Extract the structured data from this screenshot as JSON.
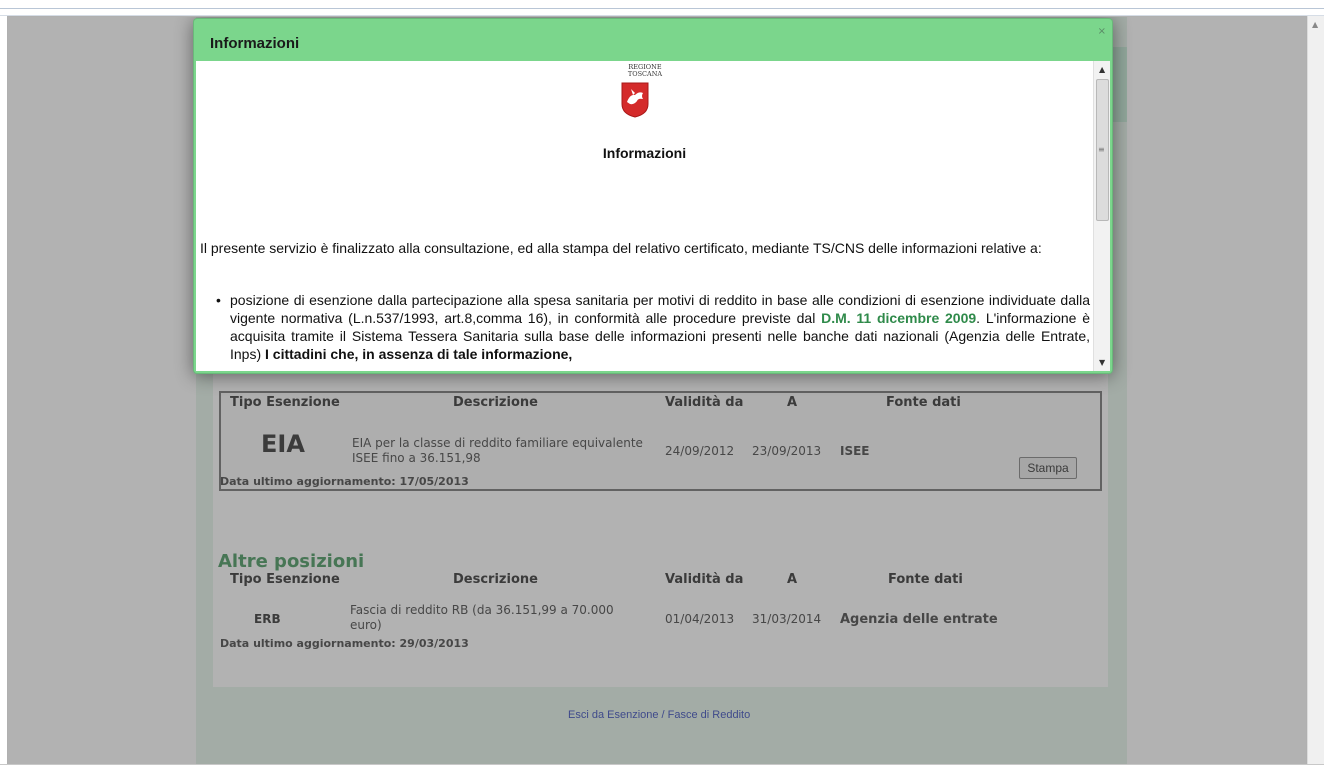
{
  "page": {
    "exempt_table": {
      "headers": [
        "Tipo Esenzione",
        "Descrizione",
        "Validità da",
        "A",
        "Fonte dati"
      ],
      "row": {
        "code": "EIA",
        "description": "EIA per la classe di reddito familiare equivalente ISEE fino a 36.151,98",
        "from": "24/09/2012",
        "to": "23/09/2013",
        "source": "ISEE",
        "print_label": "Stampa"
      },
      "last_update": "Data ultimo aggiornamento: 17/05/2013"
    },
    "other_title": "Altre posizioni",
    "other_table": {
      "headers": [
        "Tipo Esenzione",
        "Descrizione",
        "Validità da",
        "A",
        "Fonte dati"
      ],
      "row": {
        "code": "ERB",
        "description": "Fascia di reddito RB (da 36.151,99 a 70.000 euro)",
        "from": "01/04/2013",
        "to": "31/03/2014",
        "source": "Agenzia delle entrate"
      },
      "last_update": "Data ultimo aggiornamento: 29/03/2013"
    },
    "exit_link": "Esci da Esenzione / Fasce di Reddito"
  },
  "dialog": {
    "title": "Informazioni",
    "close": "×",
    "logo_line1": "REGIONE",
    "logo_line2": "TOSCANA",
    "body_title": "Informazioni",
    "intro": "Il presente servizio è finalizzato alla consultazione, ed alla stampa del relativo certificato, mediante TS/CNS delle informazioni relative a:",
    "bullet_part1": "posizione di esenzione dalla partecipazione alla spesa sanitaria per motivi di reddito in base alle condizioni di esenzione individuate dalla vigente normativa (L.n.537/1993, art.8,comma 16), in conformità alle procedure previste dal ",
    "bullet_link": "D.M. 11 dicembre 2009",
    "bullet_part2": ". L'informazione è acquisita tramite il Sistema Tessera Sanitaria sulla base delle informazioni presenti nelle banche dati nazionali (Agenzia delle Entrate, Inps) ",
    "bullet_bold": "I cittadini che, in assenza di tale informazione,"
  },
  "colors": {
    "dialog_header": "#7bd68c",
    "link_green": "#2f8a4a",
    "section_green": "#66aa7a"
  }
}
